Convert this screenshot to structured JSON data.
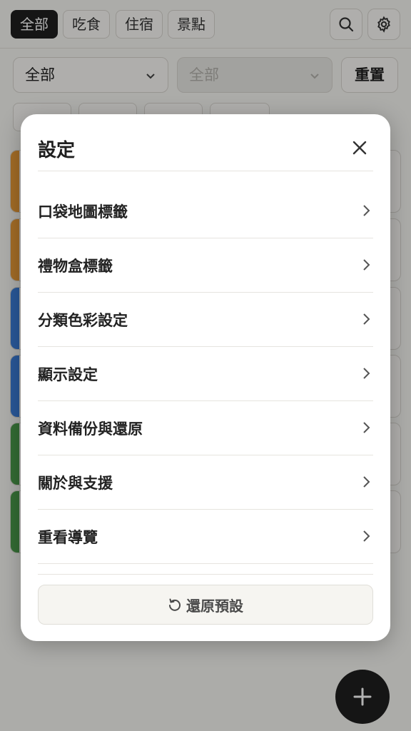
{
  "topbar": {
    "chips": [
      "全部",
      "吃食",
      "住宿",
      "景點"
    ],
    "active_chip": "全部",
    "icons": [
      "search-icon",
      "gear-icon"
    ]
  },
  "filters": {
    "primary_select": "全部",
    "secondary_select": "全部",
    "reset_label": "重置"
  },
  "category_colors": [
    "#e79a37",
    "#e79a37",
    "#3b7dd8",
    "#3b7dd8",
    "#4a9a4a",
    "#4a9a4a"
  ],
  "settings_modal": {
    "title": "設定",
    "close_icon": "close-icon",
    "items": [
      {
        "label": "口袋地圖標籤"
      },
      {
        "label": "禮物盒標籤"
      },
      {
        "label": "分類色彩設定"
      },
      {
        "label": "顯示設定"
      },
      {
        "label": "資料備份與還原"
      },
      {
        "label": "關於與支援"
      },
      {
        "label": "重看導覽"
      }
    ],
    "restore_label": "還原預設",
    "restore_icon": "restore-icon"
  },
  "fab_icon": "plus-icon"
}
